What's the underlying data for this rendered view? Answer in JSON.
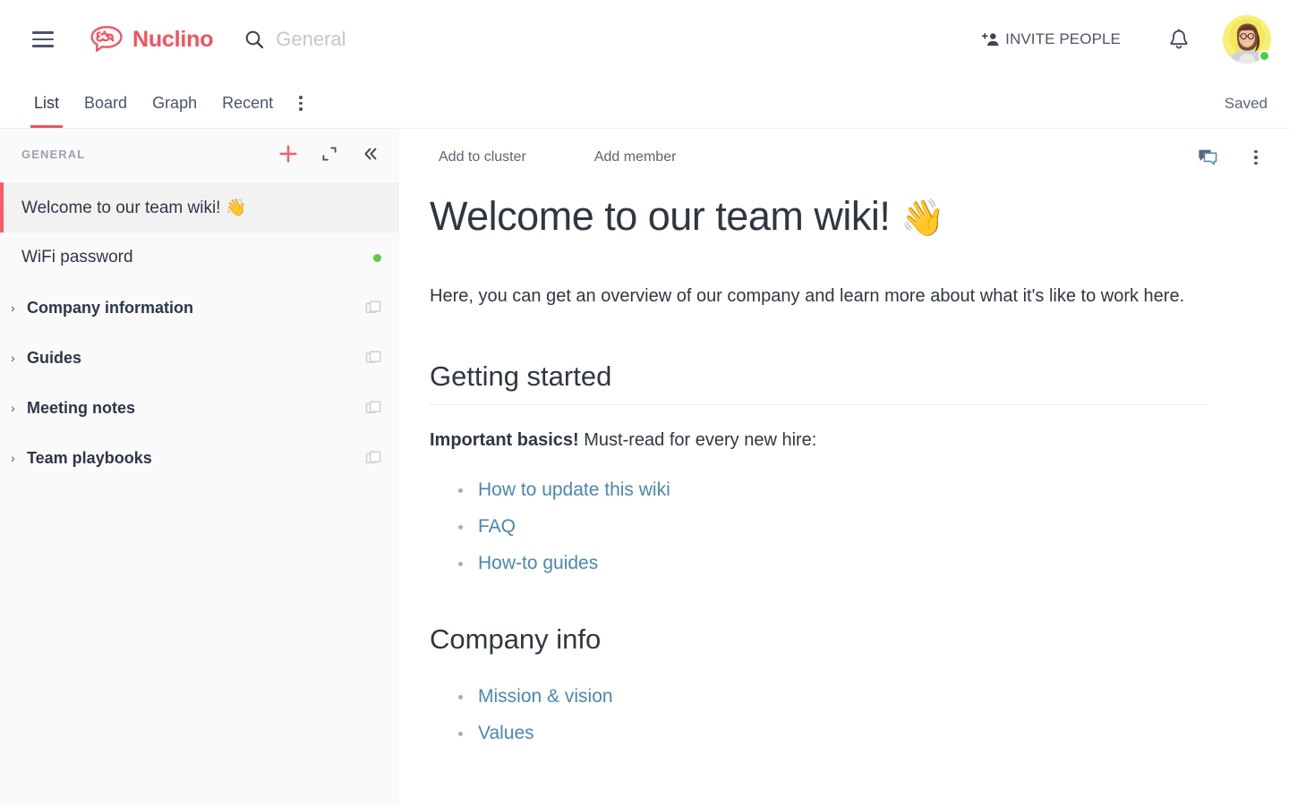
{
  "app": {
    "brand_name": "Nuclino",
    "brand_icon": "nuclino-brain-logo-icon",
    "accent_color": "#f4515e",
    "link_color": "#4a87b0"
  },
  "header": {
    "menu_icon": "hamburger-menu-icon",
    "search": {
      "icon": "search-icon",
      "value": "General",
      "placeholder": "General"
    },
    "invite_label": "INVITE PEOPLE",
    "invite_icon": "add-person-icon",
    "notifications_icon": "bell-icon",
    "avatar_icon": "user-avatar",
    "status": "online",
    "status_color": "#46d146"
  },
  "tabbar": {
    "tabs": [
      {
        "label": "List",
        "active": true
      },
      {
        "label": "Board",
        "active": false
      },
      {
        "label": "Graph",
        "active": false
      },
      {
        "label": "Recent",
        "active": false
      }
    ],
    "more_icon": "more-vertical-icon",
    "save_status": "Saved"
  },
  "sidebar": {
    "title": "GENERAL",
    "actions": [
      {
        "name": "add-item-button",
        "icon": "plus-icon"
      },
      {
        "name": "expand-sidebar-button",
        "icon": "expand-icon"
      },
      {
        "name": "collapse-sidebar-button",
        "icon": "double-chevron-left-icon"
      }
    ],
    "items": [
      {
        "label": "Welcome to our team wiki! 👋",
        "type": "item",
        "selected": true,
        "badge": "none"
      },
      {
        "label": "WiFi password",
        "type": "item",
        "selected": false,
        "badge": "green-dot"
      },
      {
        "label": "Company information",
        "type": "cluster",
        "selected": false,
        "badge": "stack-icon"
      },
      {
        "label": "Guides",
        "type": "cluster",
        "selected": false,
        "badge": "stack-icon"
      },
      {
        "label": "Meeting notes",
        "type": "cluster",
        "selected": false,
        "badge": "stack-icon"
      },
      {
        "label": "Team playbooks",
        "type": "cluster",
        "selected": false,
        "badge": "stack-icon"
      }
    ]
  },
  "content": {
    "toolbar": {
      "add_to_cluster": "Add to cluster",
      "add_member": "Add member",
      "comments_icon": "comment-bubble-icon",
      "more_icon": "more-vertical-icon"
    },
    "doc": {
      "title": "Welcome to our team wiki!",
      "title_emoji": "👋",
      "intro": "Here, you can get an overview of our company and learn more about what it's like to work here.",
      "sections": [
        {
          "heading": "Getting started",
          "rule": true,
          "lead_bold": "Important basics!",
          "lead_rest": " Must-read for every new hire:",
          "links": [
            "How to update this wiki",
            "FAQ",
            "How-to guides"
          ]
        },
        {
          "heading": "Company info",
          "rule": false,
          "lead_bold": "",
          "lead_rest": "",
          "links": [
            "Mission & vision",
            "Values"
          ]
        }
      ]
    }
  }
}
